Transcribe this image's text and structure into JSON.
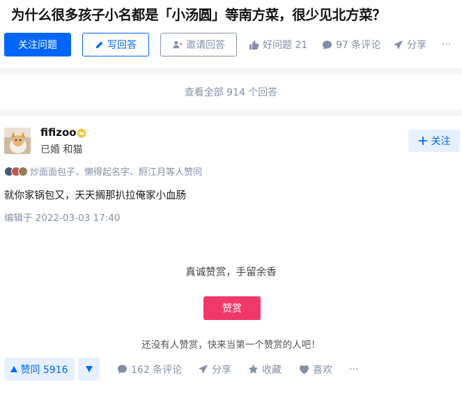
{
  "question": {
    "title": "为什么很多孩子小名都是「小汤圆」等南方菜，很少见北方菜？",
    "follow_label": "关注问题",
    "write_label": "写回答",
    "invite_label": "邀请回答",
    "good_question": "好问题 21",
    "comments": "97 条评论",
    "share": "分享",
    "more": "···"
  },
  "view_all": "查看全部 914 个回答",
  "answer": {
    "author": "fifizoo",
    "headline": "已婚 和猫",
    "follow_label": "关注",
    "upvoters_text": "炒面面包子、懒得起名字、酹江月等人赞同",
    "content": "就你家锅包又，天天搁那扒拉俺家小血肠",
    "edited": "编辑于 2022-03-03 17:40",
    "reward_prompt": "真诚赞赏，手留余香",
    "reward_button": "赞赏",
    "reward_note": "还没有人赞赏，快来当第一个赞赏的人吧！",
    "upvote_label": "赞同 5916",
    "comments": "162 条评论",
    "share": "分享",
    "collect": "收藏",
    "like": "喜欢",
    "more": "···"
  },
  "colors": {
    "brand_blue": "#0066ff",
    "muted_gray": "#8590a6",
    "reward_pink": "#f1386a",
    "light_blue_bg": "#e7f0ff"
  }
}
